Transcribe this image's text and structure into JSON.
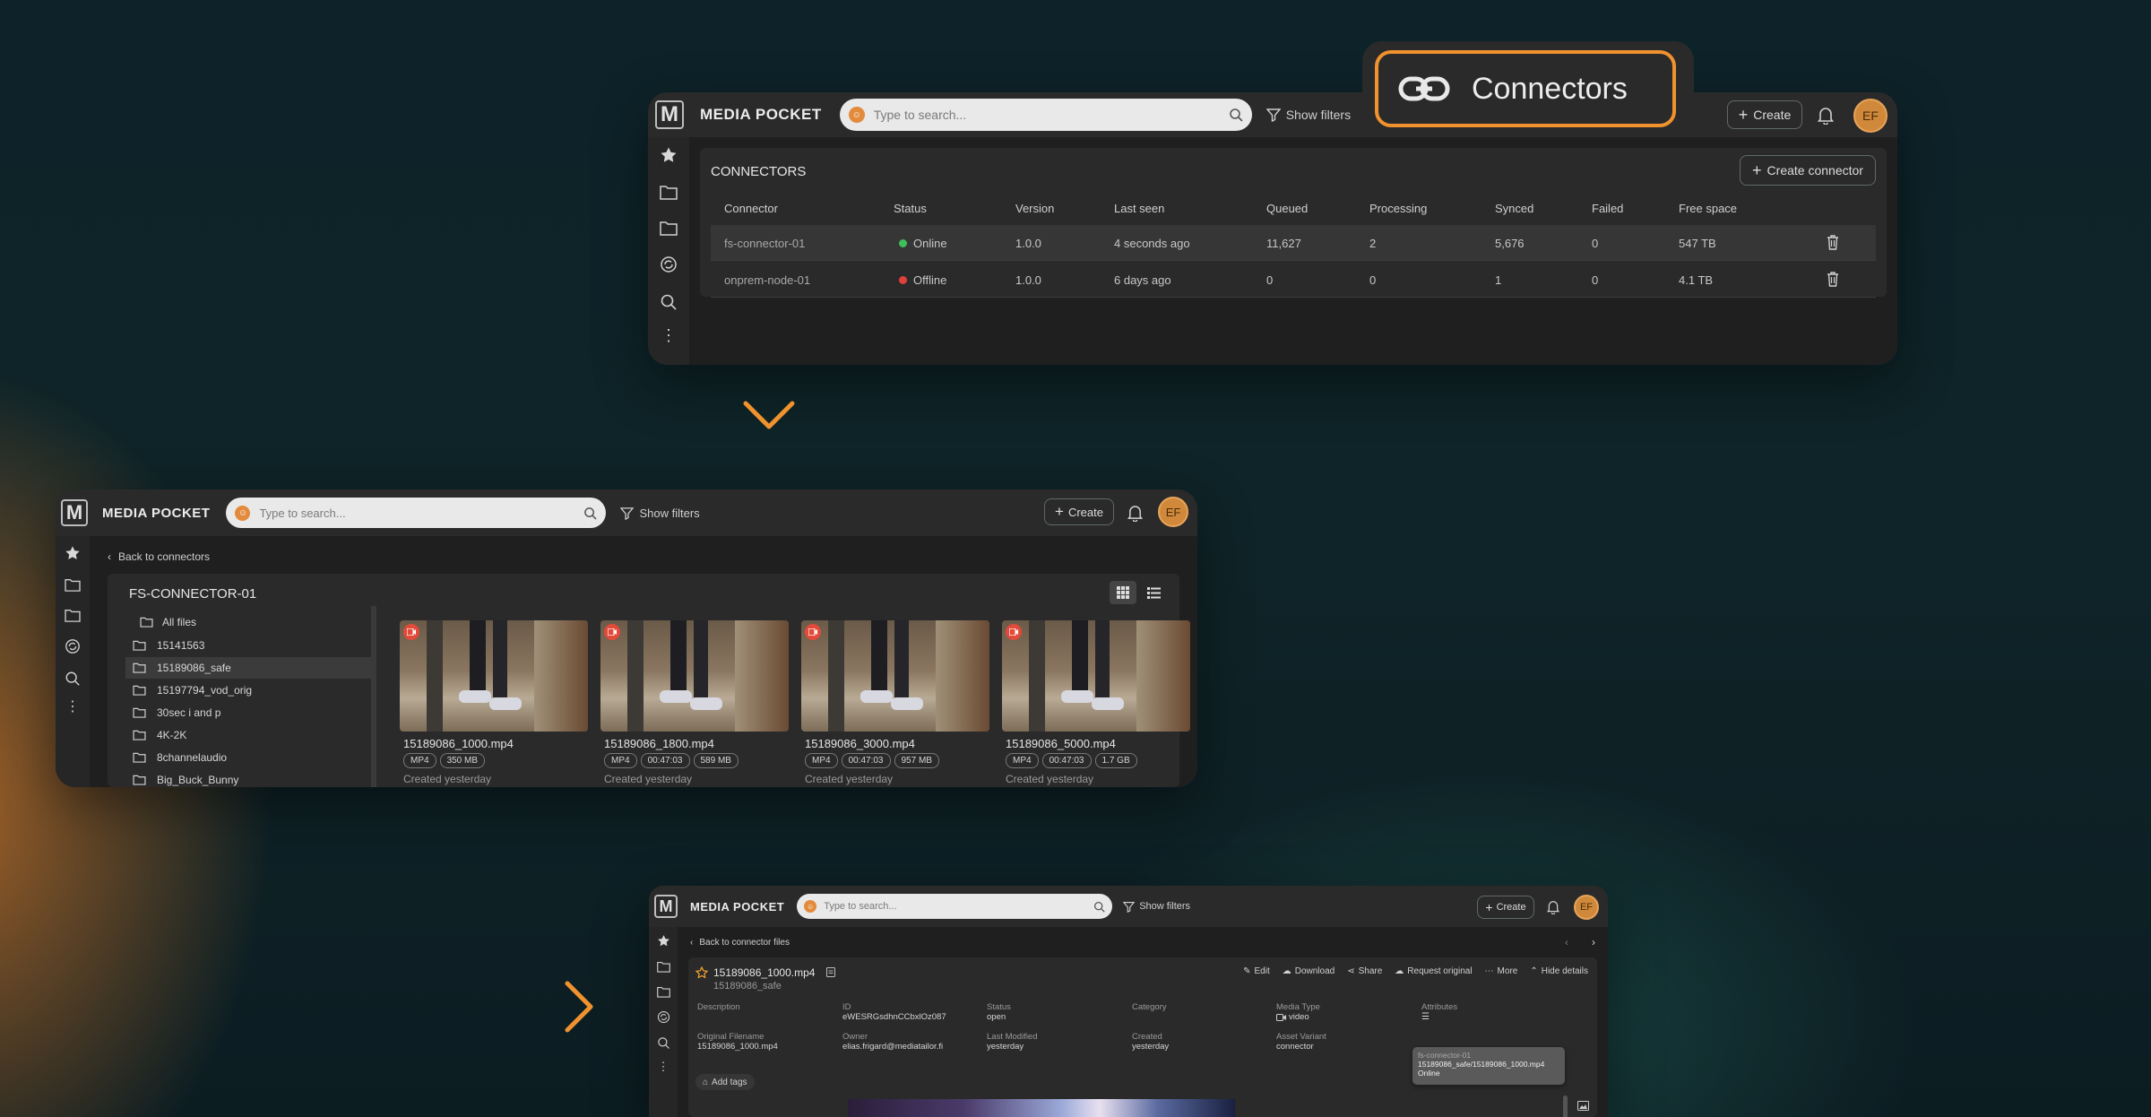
{
  "callout": {
    "label": "Connectors",
    "icon": "link-icon"
  },
  "app": {
    "brand": "MEDIA POCKET",
    "search_placeholder": "Type to search...",
    "show_filters": "Show filters",
    "create": "Create",
    "avatar": "EF"
  },
  "connectors_page": {
    "title": "CONNECTORS",
    "create_button": "Create connector",
    "columns": [
      "Connector",
      "Status",
      "Version",
      "Last seen",
      "Queued",
      "Processing",
      "Synced",
      "Failed",
      "Free space"
    ],
    "rows": [
      {
        "name": "fs-connector-01",
        "status": "Online",
        "status_color": "#3fbf5a",
        "version": "1.0.0",
        "last_seen": "4 seconds ago",
        "queued": "11,627",
        "processing": "2",
        "synced": "5,676",
        "failed": "0",
        "free": "547 TB"
      },
      {
        "name": "onprem-node-01",
        "status": "Offline",
        "status_color": "#e0413a",
        "version": "1.0.0",
        "last_seen": "6 days ago",
        "queued": "0",
        "processing": "0",
        "synced": "1",
        "failed": "0",
        "free": "4.1 TB"
      }
    ]
  },
  "files_page": {
    "back": "Back to connectors",
    "title": "FS-CONNECTOR-01",
    "tree": [
      "All files",
      "15141563",
      "15189086_safe",
      "15197794_vod_orig",
      "30sec i and p",
      "4K-2K",
      "8channelaudio",
      "Big_Buck_Bunny"
    ],
    "selected_index": 2,
    "files": [
      {
        "name": "15189086_1000.mp4",
        "tags": [
          "MP4",
          "350 MB"
        ],
        "created": "Created yesterday"
      },
      {
        "name": "15189086_1800.mp4",
        "tags": [
          "MP4",
          "00:47:03",
          "589 MB"
        ],
        "created": "Created yesterday"
      },
      {
        "name": "15189086_3000.mp4",
        "tags": [
          "MP4",
          "00:47:03",
          "957 MB"
        ],
        "created": "Created yesterday"
      },
      {
        "name": "15189086_5000.mp4",
        "tags": [
          "MP4",
          "00:47:03",
          "1.7 GB"
        ],
        "created": "Created yesterday"
      }
    ]
  },
  "detail_page": {
    "back": "Back to connector files",
    "file_name": "15189086_1000.mp4",
    "folder": "15189086_safe",
    "actions": [
      "Edit",
      "Download",
      "Share",
      "Request original",
      "More",
      "Hide details"
    ],
    "fields": [
      {
        "label": "Description",
        "value": ""
      },
      {
        "label": "ID",
        "value": "eWESRGsdhnCCbxlOz087"
      },
      {
        "label": "Status",
        "value": "open"
      },
      {
        "label": "Category",
        "value": ""
      },
      {
        "label": "Media Type",
        "value": "video"
      },
      {
        "label": "Attributes",
        "value": ""
      },
      {
        "label": "Original Filename",
        "value": "15189086_1000.mp4"
      },
      {
        "label": "Owner",
        "value": "elias.frigard@mediatailor.fi"
      },
      {
        "label": "Last Modified",
        "value": "yesterday"
      },
      {
        "label": "Created",
        "value": "yesterday"
      },
      {
        "label": "Asset Variant",
        "value": "connector"
      }
    ],
    "tooltip": {
      "line1": "fs-connector-01",
      "line2": "15189086_safe/15189086_1000.mp4",
      "line3": "Online"
    },
    "add_tags": "Add tags"
  }
}
